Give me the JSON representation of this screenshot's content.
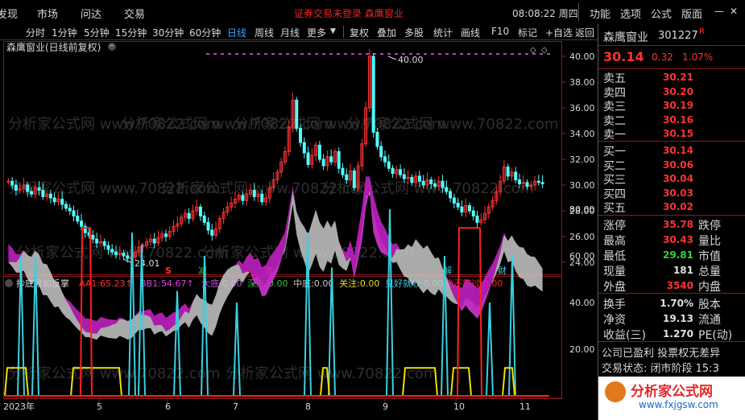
{
  "menubar": {
    "left_items": [
      "发现",
      "市场",
      "问达",
      "交易"
    ],
    "notice": "证券交易未登录  森鹰窗业",
    "clock": "08:08:22 周四",
    "right_items": [
      "功能",
      "选项",
      "公式",
      "版面"
    ]
  },
  "periods": {
    "items": [
      "分时",
      "1分钟",
      "5分钟",
      "15分钟",
      "30分钟",
      "60分钟",
      "日线",
      "周线",
      "月线",
      "更多"
    ],
    "active": "日线",
    "tools": [
      "复权",
      "叠加",
      "多股",
      "统计",
      "画线",
      "F10",
      "标记",
      "+自选",
      "返回"
    ]
  },
  "main_chart": {
    "title": "森鹰窗业(日线前复权)",
    "y_ticks": [
      "40.00",
      "38.00",
      "36.00",
      "34.00",
      "32.00",
      "30.00",
      "28.00",
      "26.00",
      "24.00"
    ],
    "high_label": "40.00",
    "low_label": "24.01",
    "signals": [
      "S",
      "减",
      "激",
      "解",
      "财"
    ],
    "watermark": "分析家公式网 www.70822.com"
  },
  "indicator": {
    "name": "抄底易如反掌",
    "values": [
      {
        "label": "AA1:",
        "value": "65.23↑",
        "color": "#ff3232"
      },
      {
        "label": "BB1:",
        "value": "54.67↑",
        "color": "#e040e0"
      },
      {
        "label": "大底:",
        "value": "0.00",
        "color": "#c050e0"
      },
      {
        "label": "深底:",
        "value": "0.00",
        "color": "#36c236"
      },
      {
        "label": "中底:",
        "value": "0.00",
        "color": "#c8c8c8"
      },
      {
        "label": "关注:",
        "value": "0.00",
        "color": "#f0e000"
      },
      {
        "label": "见好就收:",
        "value": "0.00",
        "color": "#3ad0e0"
      },
      {
        "label": "绝不错过:",
        "value": "0.00",
        "color": "#ff2020"
      }
    ],
    "y_ticks": [
      "80.00",
      "60.00",
      "40.00",
      "20.00"
    ]
  },
  "x_axis": {
    "labels": [
      "2023年",
      "5",
      "6",
      "7",
      "8",
      "9",
      "10",
      "11"
    ]
  },
  "quote": {
    "name": "森鹰窗业",
    "code": "301227",
    "tag": "R",
    "price": "30.14",
    "change": "0.32",
    "pct": "1.07%",
    "asks": [
      {
        "label": "卖五",
        "price": "30.21"
      },
      {
        "label": "卖四",
        "price": "30.20"
      },
      {
        "label": "卖三",
        "price": "30.19"
      },
      {
        "label": "卖二",
        "price": "30.16"
      },
      {
        "label": "卖一",
        "price": "30.15"
      }
    ],
    "bids": [
      {
        "label": "买一",
        "price": "30.14"
      },
      {
        "label": "买二",
        "price": "30.06"
      },
      {
        "label": "买三",
        "price": "30.04"
      },
      {
        "label": "买四",
        "price": "30.03"
      },
      {
        "label": "买五",
        "price": "30.02"
      }
    ],
    "stats": [
      {
        "label": "涨停",
        "value": "35.78",
        "color": "#ff3232",
        "right": "跌停"
      },
      {
        "label": "最高",
        "value": "30.43",
        "color": "#ff3232",
        "right": "量比"
      },
      {
        "label": "最低",
        "value": "29.81",
        "color": "#36d436",
        "right": "市值"
      },
      {
        "label": "现量",
        "value": "181",
        "color": "#e0e0e0",
        "right": "总量"
      },
      {
        "label": "外盘",
        "value": "3540",
        "color": "#ff3232",
        "right": "内盘"
      }
    ],
    "stats2": [
      {
        "label": "换手",
        "value": "1.70%",
        "right": "股本"
      },
      {
        "label": "净资",
        "value": "19.13",
        "right": "流通"
      },
      {
        "label": "收益(三)",
        "value": "1.270",
        "right": "PE(动)"
      }
    ],
    "footer1": "公司已盈利 投票权无差异",
    "footer2": "交易状态: 闭市阶段 15:3",
    "brand": "分析家公式网",
    "brand_url": "www.fxjgsw.com"
  },
  "colors": {
    "up": "#ff3232",
    "down": "#54fcfc",
    "magenta": "#d030d0",
    "accent": "#3aa3ff"
  }
}
